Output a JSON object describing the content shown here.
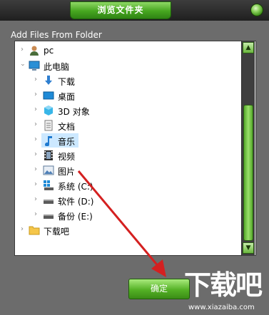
{
  "window": {
    "title": "浏览文件夹"
  },
  "dialog": {
    "prompt": "Add Files From Folder",
    "ok_label": "确定"
  },
  "tree": {
    "items": [
      {
        "label": "pc",
        "icon": "user-icon",
        "expanded": false
      },
      {
        "label": "此电脑",
        "icon": "computer-icon",
        "expanded": true
      },
      {
        "label": "下载",
        "icon": "download-folder-icon",
        "expanded": false
      },
      {
        "label": "桌面",
        "icon": "desktop-folder-icon",
        "expanded": false
      },
      {
        "label": "3D 对象",
        "icon": "3d-objects-icon",
        "expanded": false
      },
      {
        "label": "文档",
        "icon": "documents-folder-icon",
        "expanded": false
      },
      {
        "label": "音乐",
        "icon": "music-folder-icon",
        "expanded": false,
        "selected": true
      },
      {
        "label": "视频",
        "icon": "video-folder-icon",
        "expanded": false
      },
      {
        "label": "图片",
        "icon": "pictures-folder-icon",
        "expanded": false
      },
      {
        "label": "系统 (C:)",
        "icon": "system-drive-icon",
        "expanded": false
      },
      {
        "label": "软件 (D:)",
        "icon": "drive-icon",
        "expanded": false
      },
      {
        "label": "备份 (E:)",
        "icon": "drive-icon",
        "expanded": false
      },
      {
        "label": "下载吧",
        "icon": "folder-icon",
        "expanded": false
      }
    ]
  },
  "watermark": {
    "logo": "下载吧",
    "url": "www.xiazaiba.com"
  },
  "colors": {
    "accent_green": "#46a61f",
    "selection": "#cce8ff",
    "arrow_red": "#d42020"
  }
}
